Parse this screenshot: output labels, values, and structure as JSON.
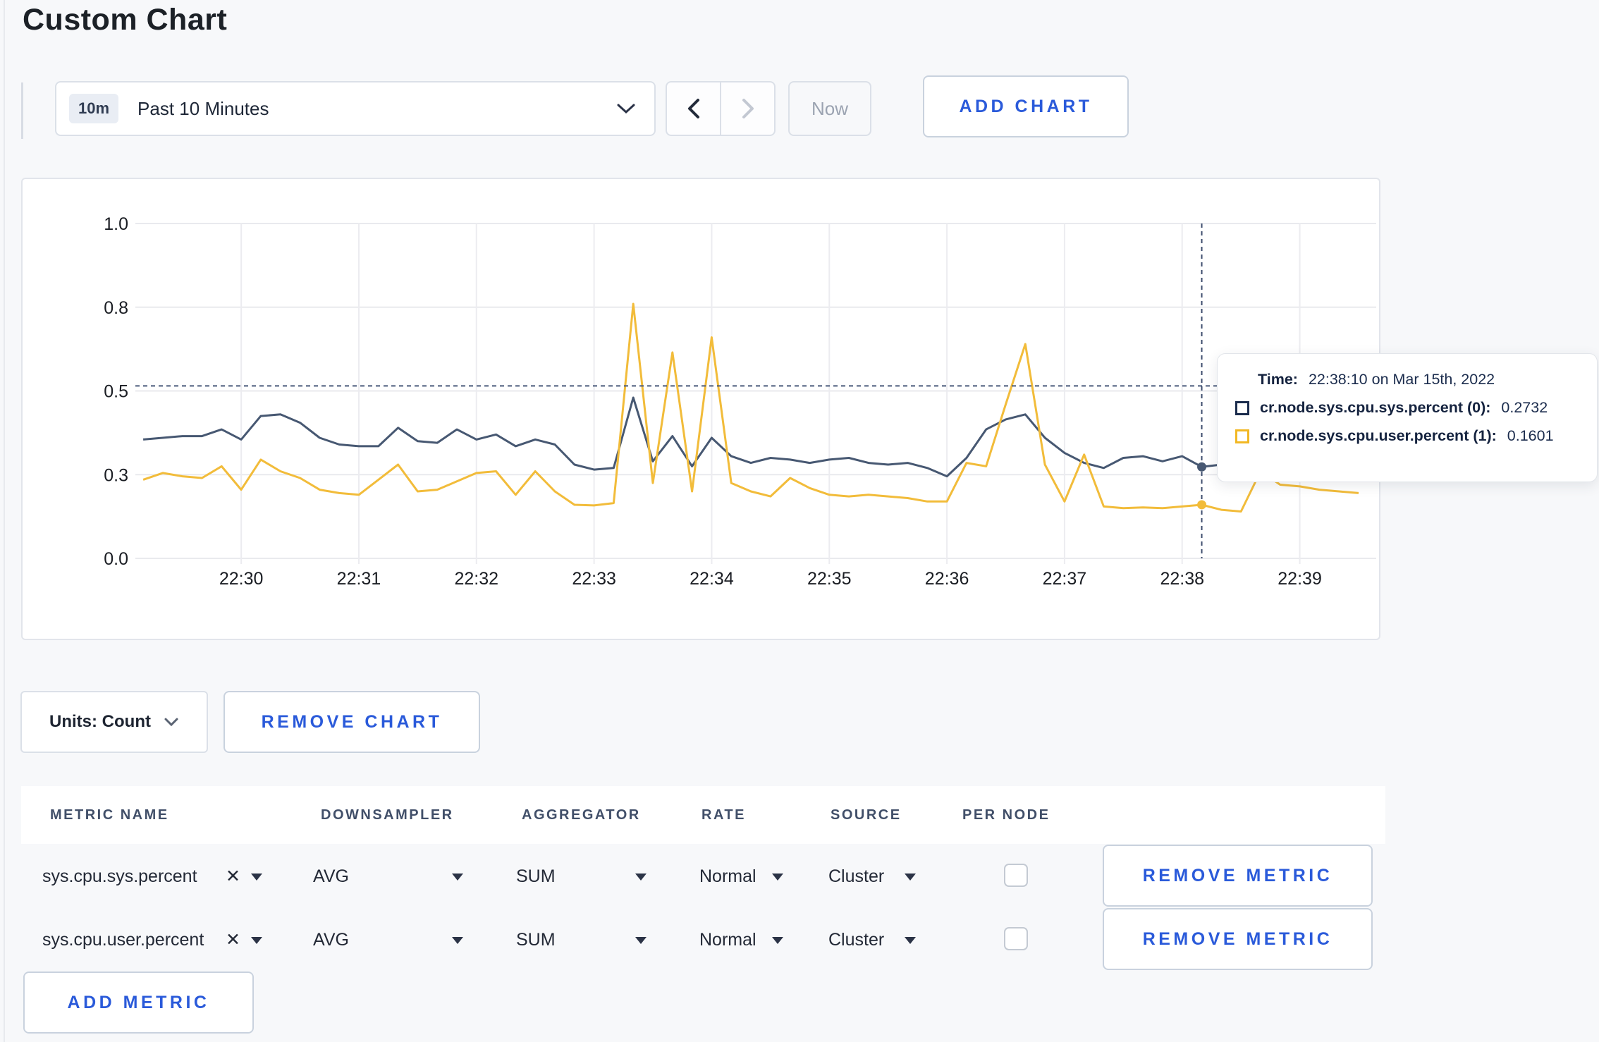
{
  "title": "Custom Chart",
  "toolbar": {
    "time_badge": "10m",
    "time_label": "Past 10 Minutes",
    "now_label": "Now",
    "add_chart_label": "ADD CHART"
  },
  "chart_controls": {
    "units_label": "Units: Count",
    "remove_chart_label": "REMOVE CHART"
  },
  "tooltip": {
    "time_label": "Time:",
    "time_value": "22:38:10 on Mar 15th, 2022",
    "series": [
      {
        "name": "cr.node.sys.cpu.sys.percent (0):",
        "value": "0.2732",
        "color": "#1b2c4d"
      },
      {
        "name": "cr.node.sys.cpu.user.percent (1):",
        "value": "0.1601",
        "color": "#f2b824"
      }
    ]
  },
  "metrics_table": {
    "headers": [
      "METRIC NAME",
      "DOWNSAMPLER",
      "AGGREGATOR",
      "RATE",
      "SOURCE",
      "PER NODE"
    ],
    "rows": [
      {
        "metric": "sys.cpu.sys.percent",
        "downsampler": "AVG",
        "aggregator": "SUM",
        "rate": "Normal",
        "source": "Cluster",
        "per_node": false,
        "remove_label": "REMOVE METRIC"
      },
      {
        "metric": "sys.cpu.user.percent",
        "downsampler": "AVG",
        "aggregator": "SUM",
        "rate": "Normal",
        "source": "Cluster",
        "per_node": false,
        "remove_label": "REMOVE METRIC"
      }
    ],
    "add_metric_label": "ADD METRIC"
  },
  "chart_data": {
    "type": "line",
    "title": "",
    "xlabel": "",
    "ylabel": "",
    "ylim": [
      0,
      1
    ],
    "y_ticks": [
      0,
      0.25,
      0.5,
      0.75,
      1
    ],
    "y_tick_labels": [
      "0.0",
      "0.3",
      "0.5",
      "0.8",
      "1.0"
    ],
    "x_ticks": [
      "22:30",
      "22:31",
      "22:32",
      "22:33",
      "22:34",
      "22:35",
      "22:36",
      "22:37",
      "22:38",
      "22:39"
    ],
    "x_domain": [
      "22:29:06",
      "22:39:39"
    ],
    "x_start": "22:29:10",
    "x_step_seconds": 10,
    "grid": true,
    "legend": "none",
    "series": [
      {
        "name": "cr.node.sys.cpu.sys.percent",
        "color": "#475872",
        "values": [
          0.355,
          0.36,
          0.365,
          0.365,
          0.385,
          0.355,
          0.425,
          0.43,
          0.405,
          0.36,
          0.34,
          0.335,
          0.335,
          0.39,
          0.35,
          0.345,
          0.385,
          0.355,
          0.37,
          0.335,
          0.355,
          0.34,
          0.28,
          0.265,
          0.27,
          0.48,
          0.29,
          0.365,
          0.275,
          0.36,
          0.305,
          0.285,
          0.3,
          0.295,
          0.285,
          0.295,
          0.3,
          0.285,
          0.28,
          0.285,
          0.27,
          0.245,
          0.3,
          0.385,
          0.415,
          0.43,
          0.36,
          0.315,
          0.285,
          0.27,
          0.3,
          0.305,
          0.29,
          0.305,
          0.2732,
          0.28,
          0.285,
          0.28,
          0.285,
          0.29,
          0.285,
          0.28,
          0.285
        ]
      },
      {
        "name": "cr.node.sys.cpu.user.percent",
        "color": "#f2bc3a",
        "values": [
          0.235,
          0.255,
          0.245,
          0.24,
          0.275,
          0.205,
          0.295,
          0.26,
          0.24,
          0.205,
          0.195,
          0.19,
          0.235,
          0.28,
          0.2,
          0.205,
          0.23,
          0.255,
          0.26,
          0.19,
          0.26,
          0.2,
          0.16,
          0.158,
          0.165,
          0.76,
          0.225,
          0.615,
          0.2,
          0.66,
          0.225,
          0.2,
          0.185,
          0.24,
          0.21,
          0.19,
          0.185,
          0.19,
          0.185,
          0.18,
          0.17,
          0.17,
          0.285,
          0.275,
          0.46,
          0.64,
          0.28,
          0.17,
          0.31,
          0.155,
          0.15,
          0.152,
          0.15,
          0.155,
          0.1601,
          0.145,
          0.14,
          0.26,
          0.22,
          0.215,
          0.205,
          0.2,
          0.195
        ]
      }
    ],
    "crosshair": {
      "time": "22:38:10",
      "hline_value": 0.515,
      "values": [
        0.2732,
        0.1601
      ]
    }
  }
}
